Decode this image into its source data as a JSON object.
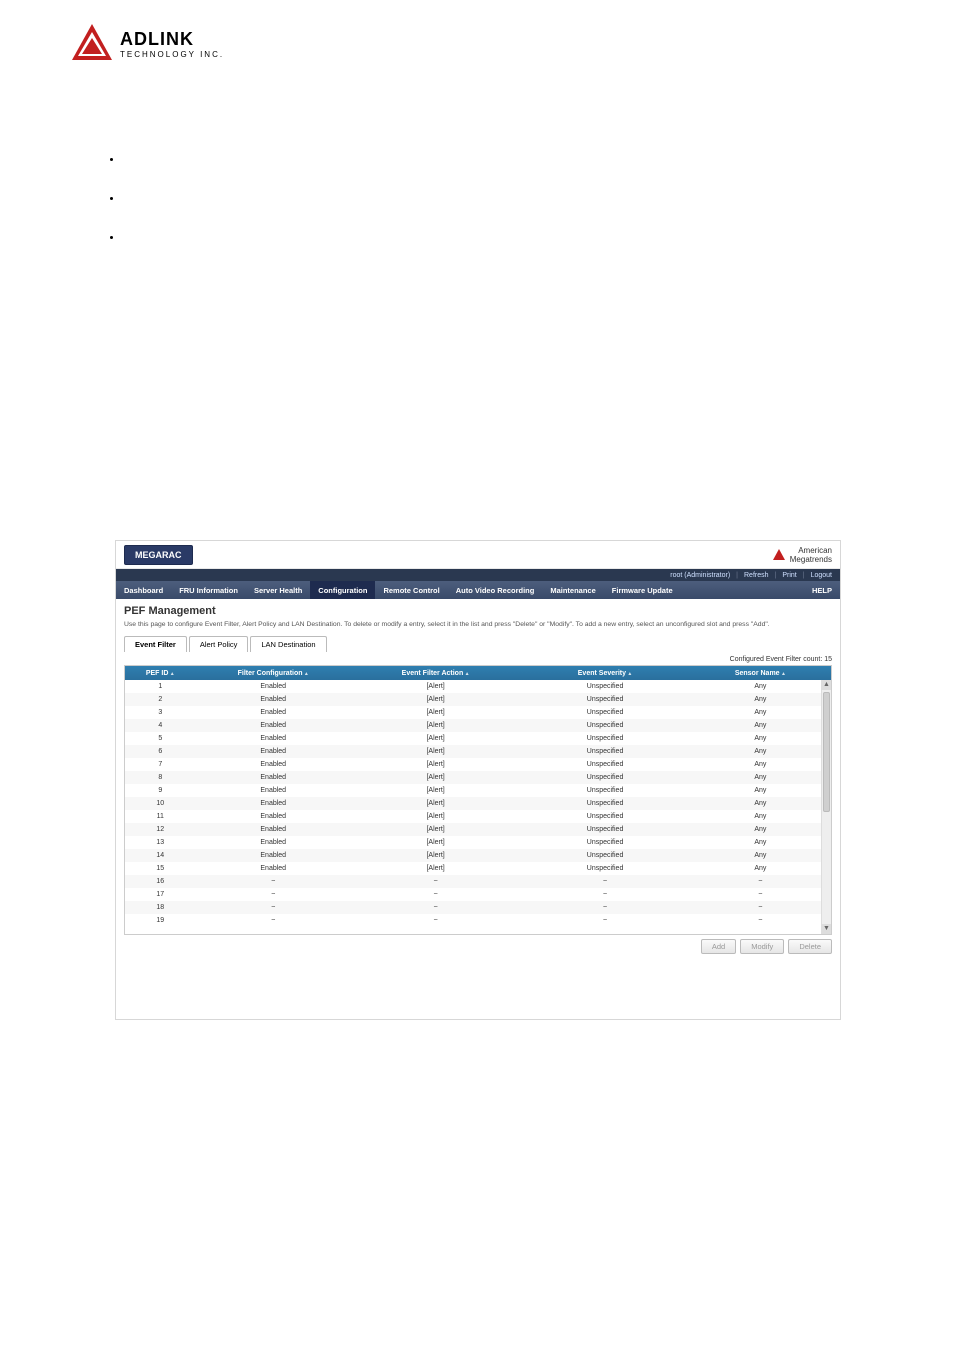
{
  "doc_logo": {
    "brand": "ADLINK",
    "sub": "TECHNOLOGY INC."
  },
  "shot": {
    "mega_label": "MEGARAC",
    "am_brand_top": "American",
    "am_brand_bot": "Megatrends",
    "userstrip": {
      "user": "root (Administrator)",
      "refresh": "Refresh",
      "print": "Print",
      "logout": "Logout"
    },
    "nav": {
      "items": [
        "Dashboard",
        "FRU Information",
        "Server Health",
        "Configuration",
        "Remote Control",
        "Auto Video Recording",
        "Maintenance",
        "Firmware Update"
      ],
      "active_index": 3,
      "help": "HELP"
    },
    "page_title": "PEF Management",
    "desc": "Use this page to configure Event Filter, Alert Policy and LAN Destination. To delete or modify a entry, select it in the list and press \"Delete\" or \"Modify\". To add a new entry, select an unconfigured slot and press \"Add\".",
    "tabs": {
      "event_filter": "Event Filter",
      "alert_policy": "Alert Policy",
      "lan_dest": "LAN Destination"
    },
    "count_label": "Configured Event Filter count: 15",
    "table": {
      "headers": {
        "pef_id": "PEF ID",
        "filter": "Filter Configuration",
        "action": "Event Filter Action",
        "severity": "Event Severity",
        "sensor": "Sensor Name"
      },
      "rows": [
        {
          "id": "1",
          "filter": "Enabled",
          "action": "[Alert]",
          "severity": "Unspecified",
          "sensor": "Any"
        },
        {
          "id": "2",
          "filter": "Enabled",
          "action": "[Alert]",
          "severity": "Unspecified",
          "sensor": "Any"
        },
        {
          "id": "3",
          "filter": "Enabled",
          "action": "[Alert]",
          "severity": "Unspecified",
          "sensor": "Any"
        },
        {
          "id": "4",
          "filter": "Enabled",
          "action": "[Alert]",
          "severity": "Unspecified",
          "sensor": "Any"
        },
        {
          "id": "5",
          "filter": "Enabled",
          "action": "[Alert]",
          "severity": "Unspecified",
          "sensor": "Any"
        },
        {
          "id": "6",
          "filter": "Enabled",
          "action": "[Alert]",
          "severity": "Unspecified",
          "sensor": "Any"
        },
        {
          "id": "7",
          "filter": "Enabled",
          "action": "[Alert]",
          "severity": "Unspecified",
          "sensor": "Any"
        },
        {
          "id": "8",
          "filter": "Enabled",
          "action": "[Alert]",
          "severity": "Unspecified",
          "sensor": "Any"
        },
        {
          "id": "9",
          "filter": "Enabled",
          "action": "[Alert]",
          "severity": "Unspecified",
          "sensor": "Any"
        },
        {
          "id": "10",
          "filter": "Enabled",
          "action": "[Alert]",
          "severity": "Unspecified",
          "sensor": "Any"
        },
        {
          "id": "11",
          "filter": "Enabled",
          "action": "[Alert]",
          "severity": "Unspecified",
          "sensor": "Any"
        },
        {
          "id": "12",
          "filter": "Enabled",
          "action": "[Alert]",
          "severity": "Unspecified",
          "sensor": "Any"
        },
        {
          "id": "13",
          "filter": "Enabled",
          "action": "[Alert]",
          "severity": "Unspecified",
          "sensor": "Any"
        },
        {
          "id": "14",
          "filter": "Enabled",
          "action": "[Alert]",
          "severity": "Unspecified",
          "sensor": "Any"
        },
        {
          "id": "15",
          "filter": "Enabled",
          "action": "[Alert]",
          "severity": "Unspecified",
          "sensor": "Any"
        },
        {
          "id": "16",
          "filter": "~",
          "action": "~",
          "severity": "~",
          "sensor": "~"
        },
        {
          "id": "17",
          "filter": "~",
          "action": "~",
          "severity": "~",
          "sensor": "~"
        },
        {
          "id": "18",
          "filter": "~",
          "action": "~",
          "severity": "~",
          "sensor": "~"
        },
        {
          "id": "19",
          "filter": "~",
          "action": "~",
          "severity": "~",
          "sensor": "~"
        }
      ]
    },
    "buttons": {
      "add": "Add",
      "modify": "Modify",
      "delete": "Delete"
    }
  }
}
